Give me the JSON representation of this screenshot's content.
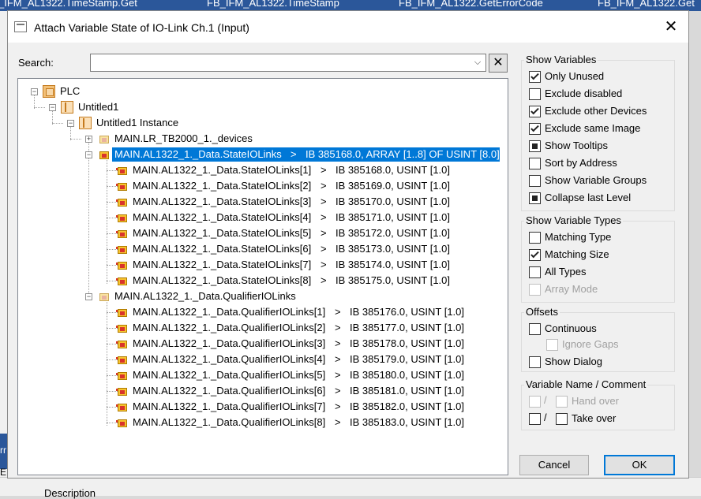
{
  "background": {
    "tabs": [
      "_IFM_AL1322.TimeStamp.Get",
      "FB_IFM_AL1322.TimeStamp",
      "FB_IFM_AL1322.GetErrorCode",
      "FB_IFM_AL1322.Get"
    ],
    "bottom_text": "Description",
    "side_letters": [
      "rr",
      "E"
    ]
  },
  "dialog": {
    "title": "Attach Variable State of IO-Link Ch.1 (Input)",
    "close_glyph": "✕",
    "search": {
      "label": "Search:",
      "value": "",
      "placeholder": "",
      "clear_glyph": "✕",
      "dropdown_glyph": "⌵"
    },
    "tree": {
      "root": "PLC",
      "project": "Untitled1",
      "instance": "Untitled1 Instance",
      "devices_node": "MAIN.LR_TB2000_1._devices",
      "state_node": {
        "name": "MAIN.AL1322_1._Data.StateIOLinks",
        "arrow": ">",
        "address": "IB 385168.0, ARRAY [1..8] OF USINT [8.0]"
      },
      "state_children": [
        {
          "name": "MAIN.AL1322_1._Data.StateIOLinks[1]",
          "arrow": ">",
          "address": "IB 385168.0, USINT [1.0]"
        },
        {
          "name": "MAIN.AL1322_1._Data.StateIOLinks[2]",
          "arrow": ">",
          "address": "IB 385169.0, USINT [1.0]"
        },
        {
          "name": "MAIN.AL1322_1._Data.StateIOLinks[3]",
          "arrow": ">",
          "address": "IB 385170.0, USINT [1.0]"
        },
        {
          "name": "MAIN.AL1322_1._Data.StateIOLinks[4]",
          "arrow": ">",
          "address": "IB 385171.0, USINT [1.0]"
        },
        {
          "name": "MAIN.AL1322_1._Data.StateIOLinks[5]",
          "arrow": ">",
          "address": "IB 385172.0, USINT [1.0]"
        },
        {
          "name": "MAIN.AL1322_1._Data.StateIOLinks[6]",
          "arrow": ">",
          "address": "IB 385173.0, USINT [1.0]"
        },
        {
          "name": "MAIN.AL1322_1._Data.StateIOLinks[7]",
          "arrow": ">",
          "address": "IB 385174.0, USINT [1.0]"
        },
        {
          "name": "MAIN.AL1322_1._Data.StateIOLinks[8]",
          "arrow": ">",
          "address": "IB 385175.0, USINT [1.0]"
        }
      ],
      "qualifier_node": "MAIN.AL1322_1._Data.QualifierIOLinks",
      "qualifier_children": [
        {
          "name": "MAIN.AL1322_1._Data.QualifierIOLinks[1]",
          "arrow": ">",
          "address": "IB 385176.0, USINT [1.0]"
        },
        {
          "name": "MAIN.AL1322_1._Data.QualifierIOLinks[2]",
          "arrow": ">",
          "address": "IB 385177.0, USINT [1.0]"
        },
        {
          "name": "MAIN.AL1322_1._Data.QualifierIOLinks[3]",
          "arrow": ">",
          "address": "IB 385178.0, USINT [1.0]"
        },
        {
          "name": "MAIN.AL1322_1._Data.QualifierIOLinks[4]",
          "arrow": ">",
          "address": "IB 385179.0, USINT [1.0]"
        },
        {
          "name": "MAIN.AL1322_1._Data.QualifierIOLinks[5]",
          "arrow": ">",
          "address": "IB 385180.0, USINT [1.0]"
        },
        {
          "name": "MAIN.AL1322_1._Data.QualifierIOLinks[6]",
          "arrow": ">",
          "address": "IB 385181.0, USINT [1.0]"
        },
        {
          "name": "MAIN.AL1322_1._Data.QualifierIOLinks[7]",
          "arrow": ">",
          "address": "IB 385182.0, USINT [1.0]"
        },
        {
          "name": "MAIN.AL1322_1._Data.QualifierIOLinks[8]",
          "arrow": ">",
          "address": "IB 385183.0, USINT [1.0]"
        }
      ]
    },
    "show_variables": {
      "title": "Show Variables",
      "options": [
        {
          "label": "Only Unused",
          "state": "checked"
        },
        {
          "label": "Exclude disabled",
          "state": "unchecked"
        },
        {
          "label": "Exclude other Devices",
          "state": "checked"
        },
        {
          "label": "Exclude same Image",
          "state": "checked"
        },
        {
          "label": "Show Tooltips",
          "state": "indeterminate"
        },
        {
          "label": "Sort by Address",
          "state": "unchecked"
        },
        {
          "label": "Show Variable Groups",
          "state": "unchecked"
        },
        {
          "label": "Collapse last Level",
          "state": "indeterminate"
        }
      ]
    },
    "show_variable_types": {
      "title": "Show Variable Types",
      "options": [
        {
          "label": "Matching Type",
          "state": "unchecked"
        },
        {
          "label": "Matching Size",
          "state": "checked"
        },
        {
          "label": "All Types",
          "state": "unchecked"
        },
        {
          "label": "Array Mode",
          "state": "disabled"
        }
      ]
    },
    "offsets": {
      "title": "Offsets",
      "continuous": "Continuous",
      "ignore_gaps": "Ignore Gaps",
      "show_dialog": "Show Dialog"
    },
    "name_comment": {
      "title": "Variable Name / Comment",
      "slash": "/",
      "hand_over": "Hand over",
      "take_over": "Take over"
    },
    "buttons": {
      "cancel": "Cancel",
      "ok": "OK"
    }
  }
}
